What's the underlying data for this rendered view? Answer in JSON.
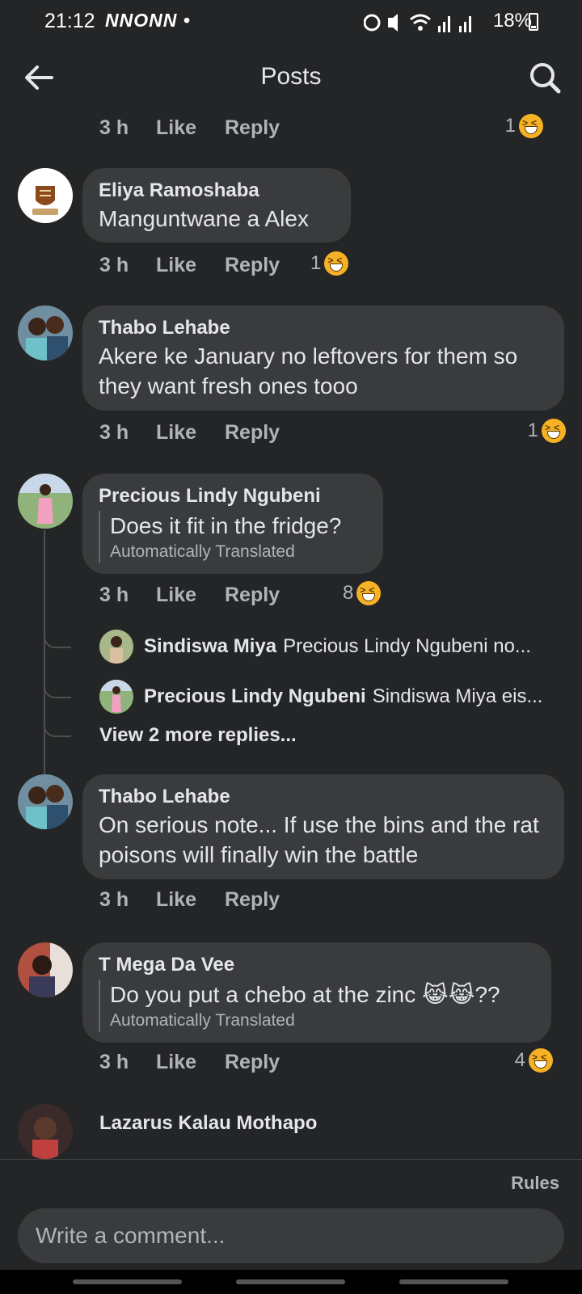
{
  "status": {
    "time": "21:12",
    "apps": "NNONN •",
    "battery": "18%"
  },
  "header": {
    "title": "Posts"
  },
  "comments": [
    {
      "time": "3 h",
      "like": "Like",
      "reply": "Reply",
      "reactions": "1"
    },
    {
      "author": "Eliya Ramoshaba",
      "text": "Manguntwane a Alex",
      "time": "3 h",
      "like": "Like",
      "reply": "Reply",
      "reactions": "1"
    },
    {
      "author": "Thabo Lehabe",
      "text": "Akere ke January no leftovers for them so they want fresh ones tooo",
      "time": "3 h",
      "like": "Like",
      "reply": "Reply",
      "reactions": "1"
    },
    {
      "author": "Precious Lindy Ngubeni",
      "text": "Does it fit in the fridge?",
      "translated": "Automatically Translated",
      "time": "3 h",
      "like": "Like",
      "reply": "Reply",
      "reactions": "8",
      "replies": [
        {
          "name": "Sindiswa Miya",
          "text": "Precious Lindy Ngubeni no..."
        },
        {
          "name": "Precious Lindy Ngubeni",
          "text": "Sindiswa Miya eis..."
        }
      ],
      "view_more": "View 2 more replies..."
    },
    {
      "author": "Thabo Lehabe",
      "text": "On serious note... If use the bins  and the rat poisons will finally win the battle",
      "time": "3 h",
      "like": "Like",
      "reply": "Reply"
    },
    {
      "author": "T Mega Da Vee",
      "text": "Do you put a chebo at the zinc 😹😹??",
      "translated": "Automatically Translated",
      "time": "3 h",
      "like": "Like",
      "reply": "Reply",
      "reactions": "4"
    },
    {
      "author": "Lazarus Kalau Mothapo"
    }
  ],
  "footer": {
    "rules": "Rules",
    "placeholder": "Write a comment..."
  }
}
